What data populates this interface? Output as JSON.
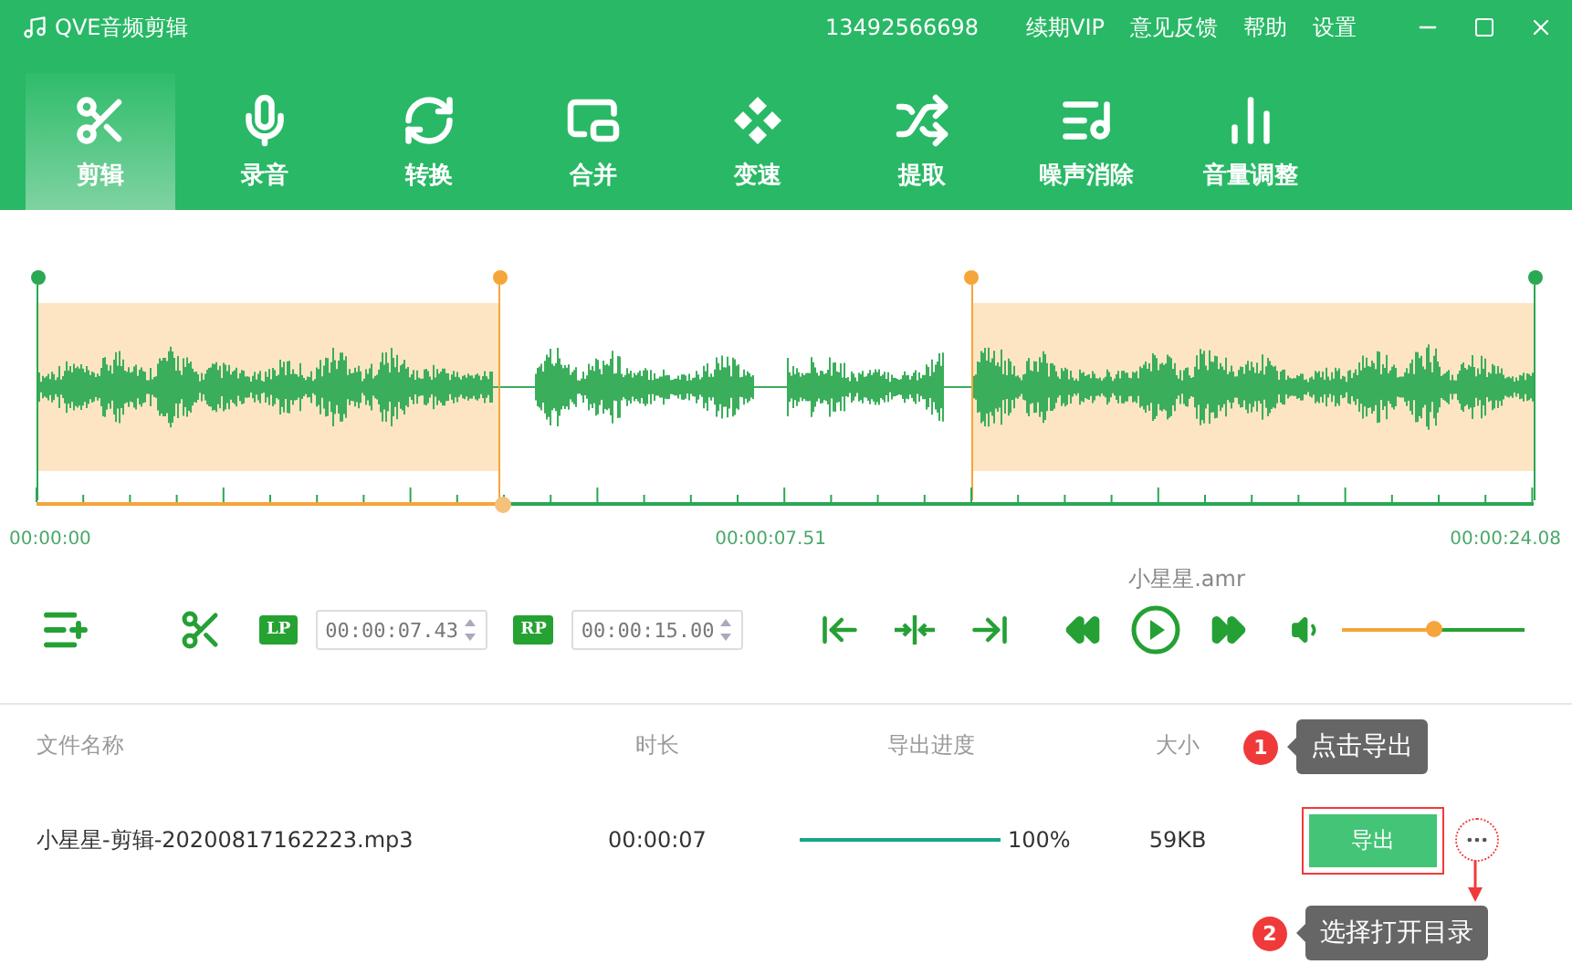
{
  "window": {
    "title": "QVE音频剪辑",
    "account": "13492566698",
    "links": [
      "续期VIP",
      "意见反馈",
      "帮助",
      "设置"
    ]
  },
  "tools": [
    {
      "label": "剪辑",
      "selected": true
    },
    {
      "label": "录音",
      "selected": false
    },
    {
      "label": "转换",
      "selected": false
    },
    {
      "label": "合并",
      "selected": false
    },
    {
      "label": "变速",
      "selected": false
    },
    {
      "label": "提取",
      "selected": false
    },
    {
      "label": "噪声消除",
      "selected": false
    },
    {
      "label": "音量调整",
      "selected": false
    }
  ],
  "editor": {
    "markers": [
      {
        "level": 0,
        "color": "#2aa852"
      },
      {
        "level": 0.309,
        "color": "#f5a53a"
      },
      {
        "level": 0.624,
        "color": "#f5a53a"
      },
      {
        "level": 1,
        "color": "#2aa852"
      }
    ],
    "playhead": {
      "level": 0.311
    },
    "times": [
      "00:00:00",
      "00:00:07.51",
      "00:00:24.08"
    ],
    "file_name": "小星星.amr",
    "lp": {
      "badge": "LP",
      "value": "00:00:07.43"
    },
    "rp": {
      "badge": "RP",
      "value": "00:00:15.00"
    },
    "volume": {
      "level": 0.5
    }
  },
  "table": {
    "columns": [
      "文件名称",
      "时长",
      "导出进度",
      "大小"
    ],
    "rows": [
      {
        "name": "小星星-剪辑-20200817162223.mp3",
        "duration": "00:00:07",
        "progress": {
          "level": 1
        },
        "percent": "100%",
        "size": "59KB",
        "action": "导出"
      }
    ]
  },
  "callouts": [
    {
      "number": "1",
      "text": "点击导出"
    },
    {
      "number": "2",
      "text": "选择打开目录"
    }
  ]
}
